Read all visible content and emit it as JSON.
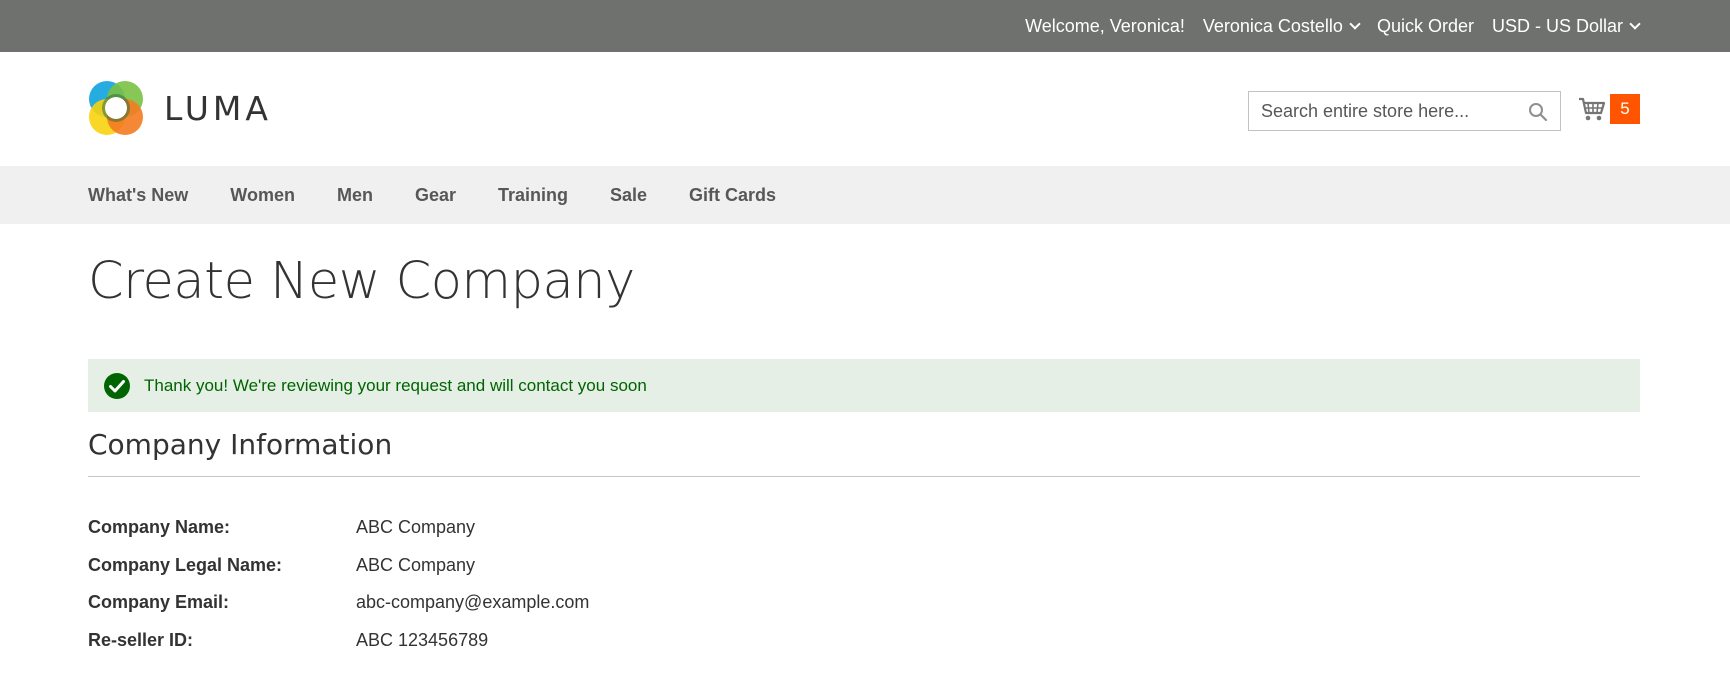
{
  "topbar": {
    "welcome": "Welcome, Veronica!",
    "account": "Veronica Costello",
    "quick_order": "Quick Order",
    "currency": "USD - US Dollar"
  },
  "header": {
    "logo_text": "LUMA",
    "search_placeholder": "Search entire store here...",
    "cart_count": "5",
    "cart_badge_color": "#ff5501"
  },
  "nav": {
    "items": [
      "What's New",
      "Women",
      "Men",
      "Gear",
      "Training",
      "Sale",
      "Gift Cards"
    ]
  },
  "page": {
    "title": "Create New Company"
  },
  "message": {
    "text": "Thank you! We're reviewing your request and will contact you soon",
    "type": "success",
    "icon": "checkmark-icon"
  },
  "company_info": {
    "title": "Company Information",
    "rows": [
      {
        "label": "Company Name:",
        "value": "ABC Company"
      },
      {
        "label": "Company Legal Name:",
        "value": "ABC Company"
      },
      {
        "label": "Company Email:",
        "value": "abc-company@example.com"
      },
      {
        "label": "Re-seller ID:",
        "value": "ABC 123456789"
      }
    ]
  }
}
